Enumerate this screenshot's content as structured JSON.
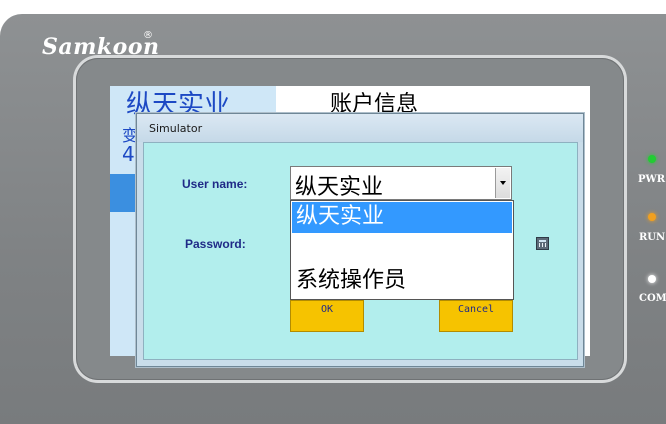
{
  "device": {
    "brand": "Samkoon",
    "brand_mark": "®",
    "indicators": [
      {
        "label": "PWR",
        "color": "#22cc33"
      },
      {
        "label": "RUN",
        "color": "#f0a020"
      },
      {
        "label": "COM",
        "color": "#ffffff"
      }
    ]
  },
  "hmi_screen": {
    "company_text": "纵天实业",
    "title_text": "账户信息",
    "partial_text_1": "变",
    "partial_text_2": "4"
  },
  "simulator": {
    "window_title": "Simulator",
    "user_label": "User name:",
    "password_label": "Password:",
    "selected_user": "纵天实业",
    "user_options": [
      "纵天实业",
      "",
      "系统操作员"
    ],
    "ok_label": "OK",
    "cancel_label": "Cancel"
  },
  "colors": {
    "client_bg": "#b2eeed",
    "selection": "#3399ff",
    "button": "#f6c300"
  }
}
